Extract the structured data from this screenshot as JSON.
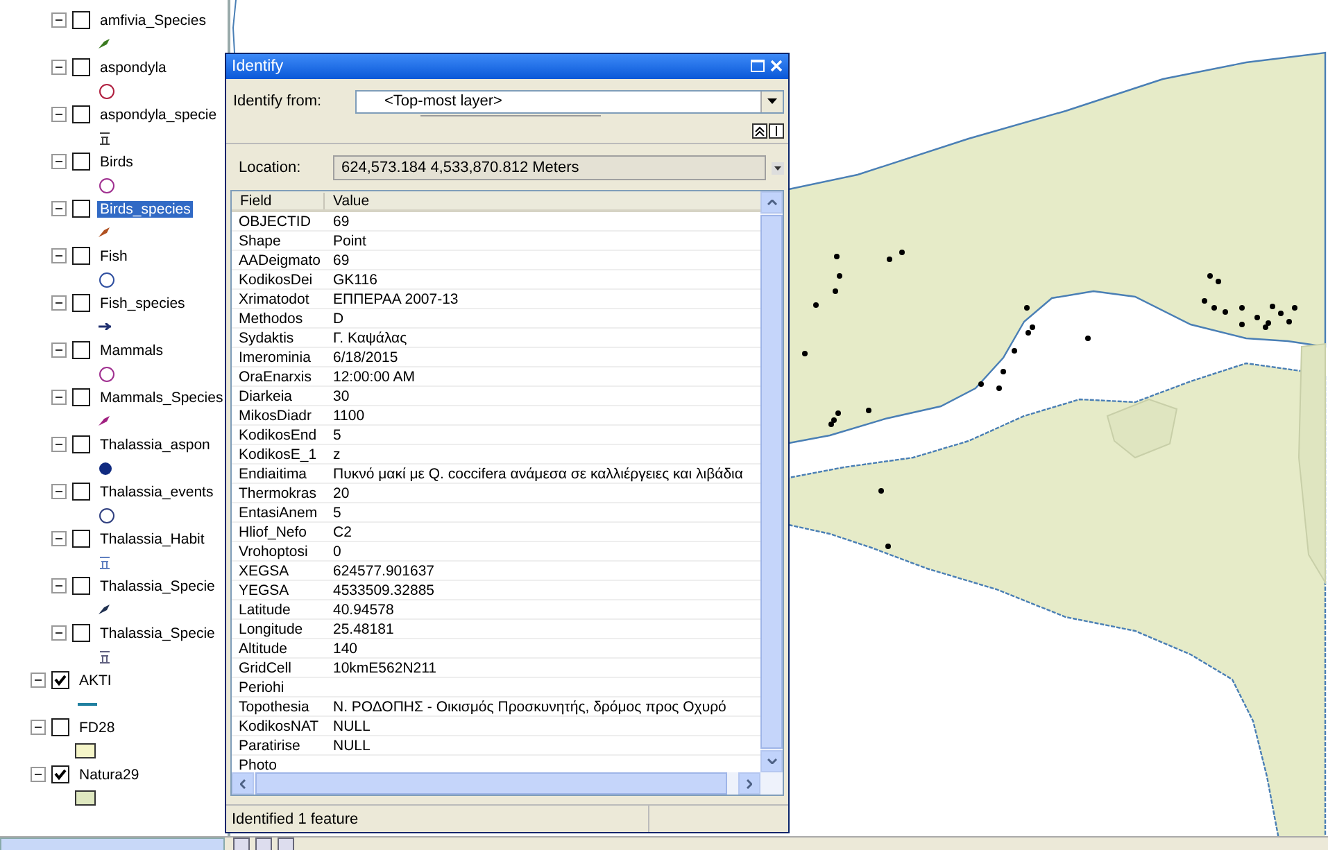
{
  "toc": {
    "layers": [
      {
        "children": [
          {
            "name": "amfivia_Species",
            "checked": false,
            "selected": false,
            "symbol": {
              "kind": "marker",
              "color": "#3a7a20"
            }
          },
          {
            "name": "aspondyla",
            "checked": false,
            "selected": false,
            "symbol": {
              "kind": "circle",
              "color": "#b02040"
            }
          },
          {
            "name": "aspondyla_specie",
            "checked": false,
            "selected": false,
            "symbol": {
              "kind": "glyph",
              "color": "#404040"
            }
          },
          {
            "name": "Birds",
            "checked": false,
            "selected": false,
            "symbol": {
              "kind": "circle",
              "color": "#a03090"
            }
          },
          {
            "name": "Birds_species",
            "checked": false,
            "selected": true,
            "symbol": {
              "kind": "marker",
              "color": "#b05020"
            }
          },
          {
            "name": "Fish",
            "checked": false,
            "selected": false,
            "symbol": {
              "kind": "circle",
              "color": "#3050a0"
            }
          },
          {
            "name": "Fish_species",
            "checked": false,
            "selected": false,
            "symbol": {
              "kind": "dash",
              "color": "#203070"
            }
          },
          {
            "name": "Mammals",
            "checked": false,
            "selected": false,
            "symbol": {
              "kind": "circle",
              "color": "#a03090"
            }
          },
          {
            "name": "Mammals_Species",
            "checked": false,
            "selected": false,
            "symbol": {
              "kind": "marker",
              "color": "#a02080"
            }
          },
          {
            "name": "Thalassia_aspon",
            "checked": false,
            "selected": false,
            "symbol": {
              "kind": "dot",
              "color": "#102a80"
            }
          },
          {
            "name": "Thalassia_events",
            "checked": false,
            "selected": false,
            "symbol": {
              "kind": "circle",
              "color": "#304080"
            }
          },
          {
            "name": "Thalassia_Habit",
            "checked": false,
            "selected": false,
            "symbol": {
              "kind": "glyph",
              "color": "#6080c0"
            }
          },
          {
            "name": "Thalassia_Specie",
            "checked": false,
            "selected": false,
            "symbol": {
              "kind": "marker",
              "color": "#203050"
            }
          },
          {
            "name": "Thalassia_Specie",
            "checked": false,
            "selected": false,
            "symbol": {
              "kind": "glyph",
              "color": "#606080"
            }
          }
        ]
      },
      {
        "name": "AKTI",
        "checked": true,
        "selected": false,
        "symbol": {
          "kind": "line",
          "color": "#2080a0"
        }
      },
      {
        "name": "FD28",
        "checked": false,
        "selected": false,
        "symbol": {
          "kind": "rect",
          "color": "#f5f5c8"
        }
      },
      {
        "name": "Natura29",
        "checked": true,
        "selected": false,
        "symbol": {
          "kind": "rect",
          "color": "#dfe8c0"
        }
      }
    ]
  },
  "window": {
    "title": "Identify"
  },
  "identify_from": {
    "label": "Identify from:",
    "value": "<Top-most layer>"
  },
  "location": {
    "label": "Location:",
    "value": "624,573.184  4,533,870.812 Meters"
  },
  "table": {
    "columns": [
      "Field",
      "Value"
    ],
    "rows": [
      {
        "field": "OBJECTID",
        "value": "69"
      },
      {
        "field": "Shape",
        "value": "Point"
      },
      {
        "field": "AADeigmato",
        "value": "69"
      },
      {
        "field": "KodikosDei",
        "value": "GK116"
      },
      {
        "field": "Xrimatodot",
        "value": "ΕΠΠΕΡΑΑ 2007-13"
      },
      {
        "field": "Methodos",
        "value": "D"
      },
      {
        "field": "Sydaktis",
        "value": "Γ. Καψάλας"
      },
      {
        "field": "Imerominia",
        "value": "6/18/2015"
      },
      {
        "field": "OraEnarxis",
        "value": "12:00:00 AM"
      },
      {
        "field": "Diarkeia",
        "value": "30"
      },
      {
        "field": "MikosDiadr",
        "value": "1100"
      },
      {
        "field": "KodikosEnd",
        "value": "5"
      },
      {
        "field": "KodikosE_1",
        "value": "z"
      },
      {
        "field": "Endiaitima",
        "value": "Πυκνό μακί με Q. coccifera ανάμεσα σε καλλιέργειες και λιβάδια"
      },
      {
        "field": "Thermokras",
        "value": "20"
      },
      {
        "field": "EntasiAnem",
        "value": "5"
      },
      {
        "field": "Hliof_Nefo",
        "value": "C2"
      },
      {
        "field": "Vrohoptosi",
        "value": "0"
      },
      {
        "field": "XEGSA",
        "value": "624577.901637"
      },
      {
        "field": "YEGSA",
        "value": "4533509.32885"
      },
      {
        "field": "Latitude",
        "value": "40.94578"
      },
      {
        "field": "Longitude",
        "value": "25.48181"
      },
      {
        "field": "Altitude",
        "value": "140"
      },
      {
        "field": "GridCell",
        "value": "10kmE562N211"
      },
      {
        "field": "Periohi"
      },
      {
        "field": "Topothesia",
        "value": "Ν. ΡΟΔΟΠΗΣ - Οικισμός Προσκυνητής, δρόμος προς Οχυρό"
      },
      {
        "field": "KodikosNAT",
        "value": "NULL"
      },
      {
        "field": "Paratirise",
        "value": "NULL"
      },
      {
        "field": "Photo"
      }
    ]
  },
  "status_bar": "Identified 1 feature"
}
